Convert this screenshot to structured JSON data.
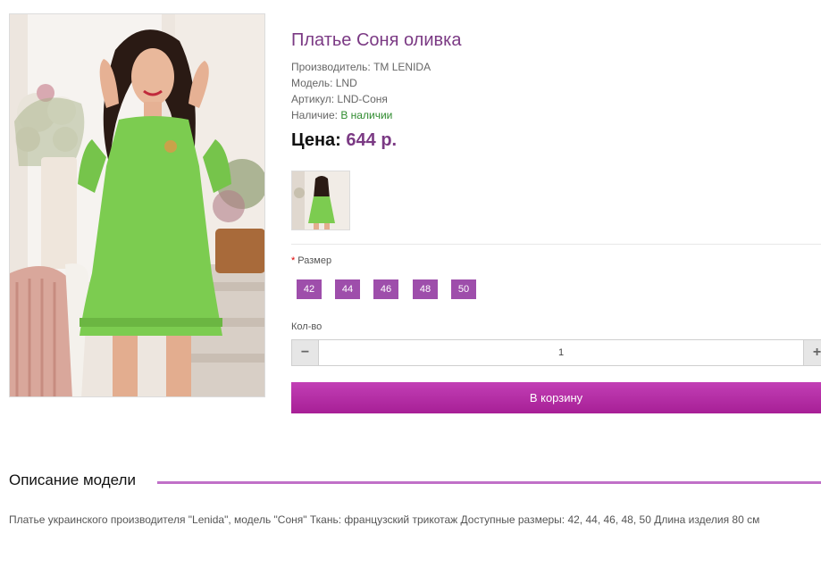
{
  "product": {
    "title": "Платье Соня оливка",
    "manufacturer": "Производитель: ТМ LENIDA",
    "model": "Модель: LND",
    "article": "Артикул: LND-Соня",
    "availability_label": "Наличие: ",
    "availability_value": "В наличии",
    "price_label": "Цена:",
    "price_value": "644 р."
  },
  "options": {
    "size_required_mark": "*",
    "size_label": "Размер",
    "sizes": [
      "42",
      "44",
      "46",
      "48",
      "50"
    ]
  },
  "quantity": {
    "label": "Кол-во",
    "value": "1",
    "minus": "−",
    "plus": "+"
  },
  "cart_button": "В корзину",
  "description": {
    "heading": "Описание модели",
    "text": "Платье украинского производителя \"Lenida\", модель \"Соня\" Ткань: французский трикотаж Доступные размеры: 42, 44, 46, 48, 50 Длина изделия 80 см"
  },
  "colors": {
    "accent_purple": "#7b3a84",
    "size_button": "#9e4eab",
    "cart_button": "#b12ea3",
    "availability_green": "#2e8b2e",
    "dress_green": "#7ccc50"
  },
  "icons": {
    "main_photo": "product-photo-green-dress",
    "thumbnail": "product-thumbnail-back-view"
  }
}
